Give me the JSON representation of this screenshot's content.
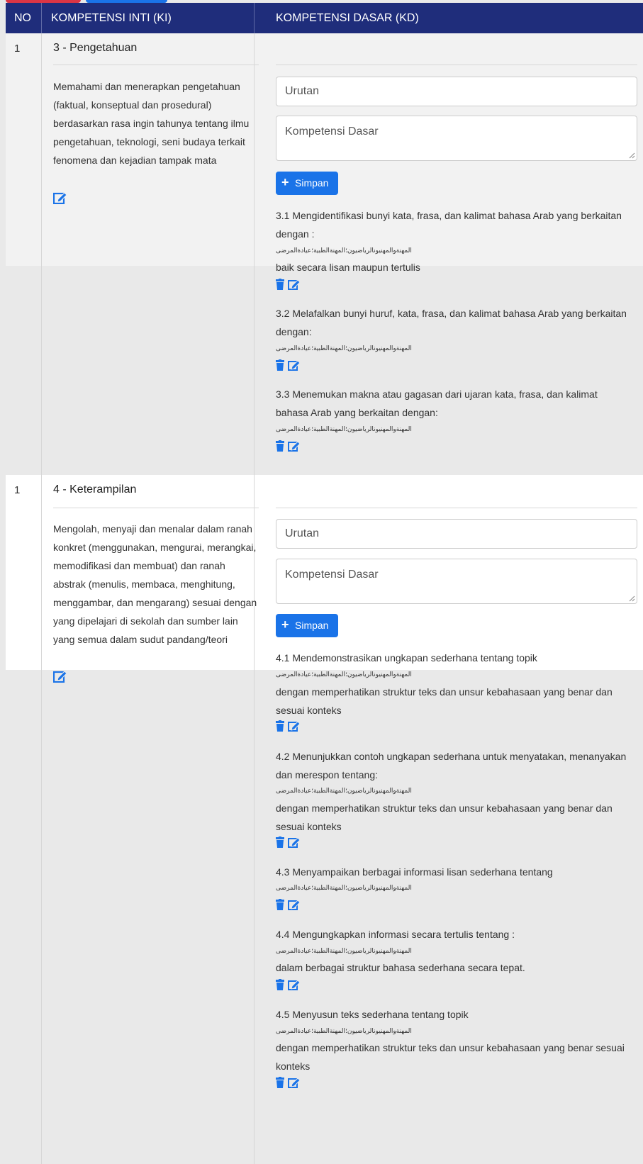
{
  "header": {
    "no": "NO",
    "ki": "KOMPETENSI INTI (KI)",
    "kd": "KOMPETENSI DASAR (KD)"
  },
  "colors": {
    "header_bg": "#1f2d7b",
    "primary": "#1a73e8",
    "danger": "#dc3545"
  },
  "form": {
    "urutan_placeholder": "Urutan",
    "kd_placeholder": "Kompetensi Dasar",
    "save_label": "Simpan"
  },
  "rows": [
    {
      "no": "1",
      "ki_title": "3 - Pengetahuan",
      "ki_text": "Memahami dan menerapkan pengetahuan (faktual, konseptual dan prosedural) berdasarkan rasa ingin tahunya tentang ilmu pengetahuan, teknologi, seni budaya terkait fenomena dan kejadian tampak mata",
      "kd": [
        {
          "text": "3.1 Mengidentifikasi bunyi kata, frasa, dan kalimat bahasa Arab yang berkaitan dengan :",
          "arabic": "المهنةوالمهنيونالرياضيون؛المهنةالطبية؛عيادةالمرضى",
          "after": "baik secara lisan maupun tertulis"
        },
        {
          "text": "3.2 Melafalkan bunyi huruf, kata, frasa, dan kalimat bahasa Arab yang berkaitan dengan:",
          "arabic": "المهنةوالمهنيونالرياضيون؛المهنةالطبية؛عيادةالمرضى",
          "after": ""
        },
        {
          "text": "3.3 Menemukan makna atau gagasan dari ujaran kata, frasa, dan kalimat bahasa Arab yang berkaitan dengan:",
          "arabic": "المهنةوالمهنيونالرياضيون؛المهنةالطبية؛عيادةالمرضى",
          "after": ""
        }
      ]
    },
    {
      "no": "1",
      "ki_title": "4 - Keterampilan",
      "ki_text": "Mengolah, menyaji dan menalar dalam ranah konkret (menggunakan, mengurai, merangkai, memodifikasi dan membuat) dan ranah abstrak (menulis, membaca, menghitung, menggambar, dan mengarang) sesuai dengan yang dipelajari di sekolah dan sumber lain yang semua dalam sudut pandang/teori",
      "kd": [
        {
          "text": "4.1 Mendemonstrasikan ungkapan sederhana tentang topik",
          "arabic": "المهنةوالمهنيونالرياضيون؛المهنةالطبية؛عيادةالمرضى",
          "after": "dengan memperhatikan struktur teks dan unsur kebahasaan yang benar dan sesuai konteks"
        },
        {
          "text": "4.2 Menunjukkan contoh ungkapan sederhana untuk menyatakan, menanyakan dan merespon tentang:",
          "arabic": "المهنةوالمهنيونالرياضيون؛المهنةالطبية؛عيادةالمرضى",
          "after": "dengan memperhatikan struktur teks dan unsur kebahasaan yang benar dan sesuai konteks"
        },
        {
          "text": "4.3 Menyampaikan berbagai informasi lisan sederhana tentang",
          "arabic": "المهنةوالمهنيونالرياضيون؛المهنةالطبية؛عيادةالمرضى",
          "after": ""
        },
        {
          "text": "4.4 Mengungkapkan informasi secara tertulis tentang :",
          "arabic": "المهنةوالمهنيونالرياضيون؛المهنةالطبية؛عيادةالمرضى",
          "after": "dalam berbagai struktur bahasa sederhana secara tepat."
        },
        {
          "text": "4.5 Menyusun teks sederhana tentang topik",
          "arabic": "المهنةوالمهنيونالرياضيون؛المهنةالطبية؛عيادةالمرضى",
          "after": "dengan memperhatikan struktur teks dan unsur kebahasaan yang benar sesuai konteks"
        }
      ]
    }
  ]
}
